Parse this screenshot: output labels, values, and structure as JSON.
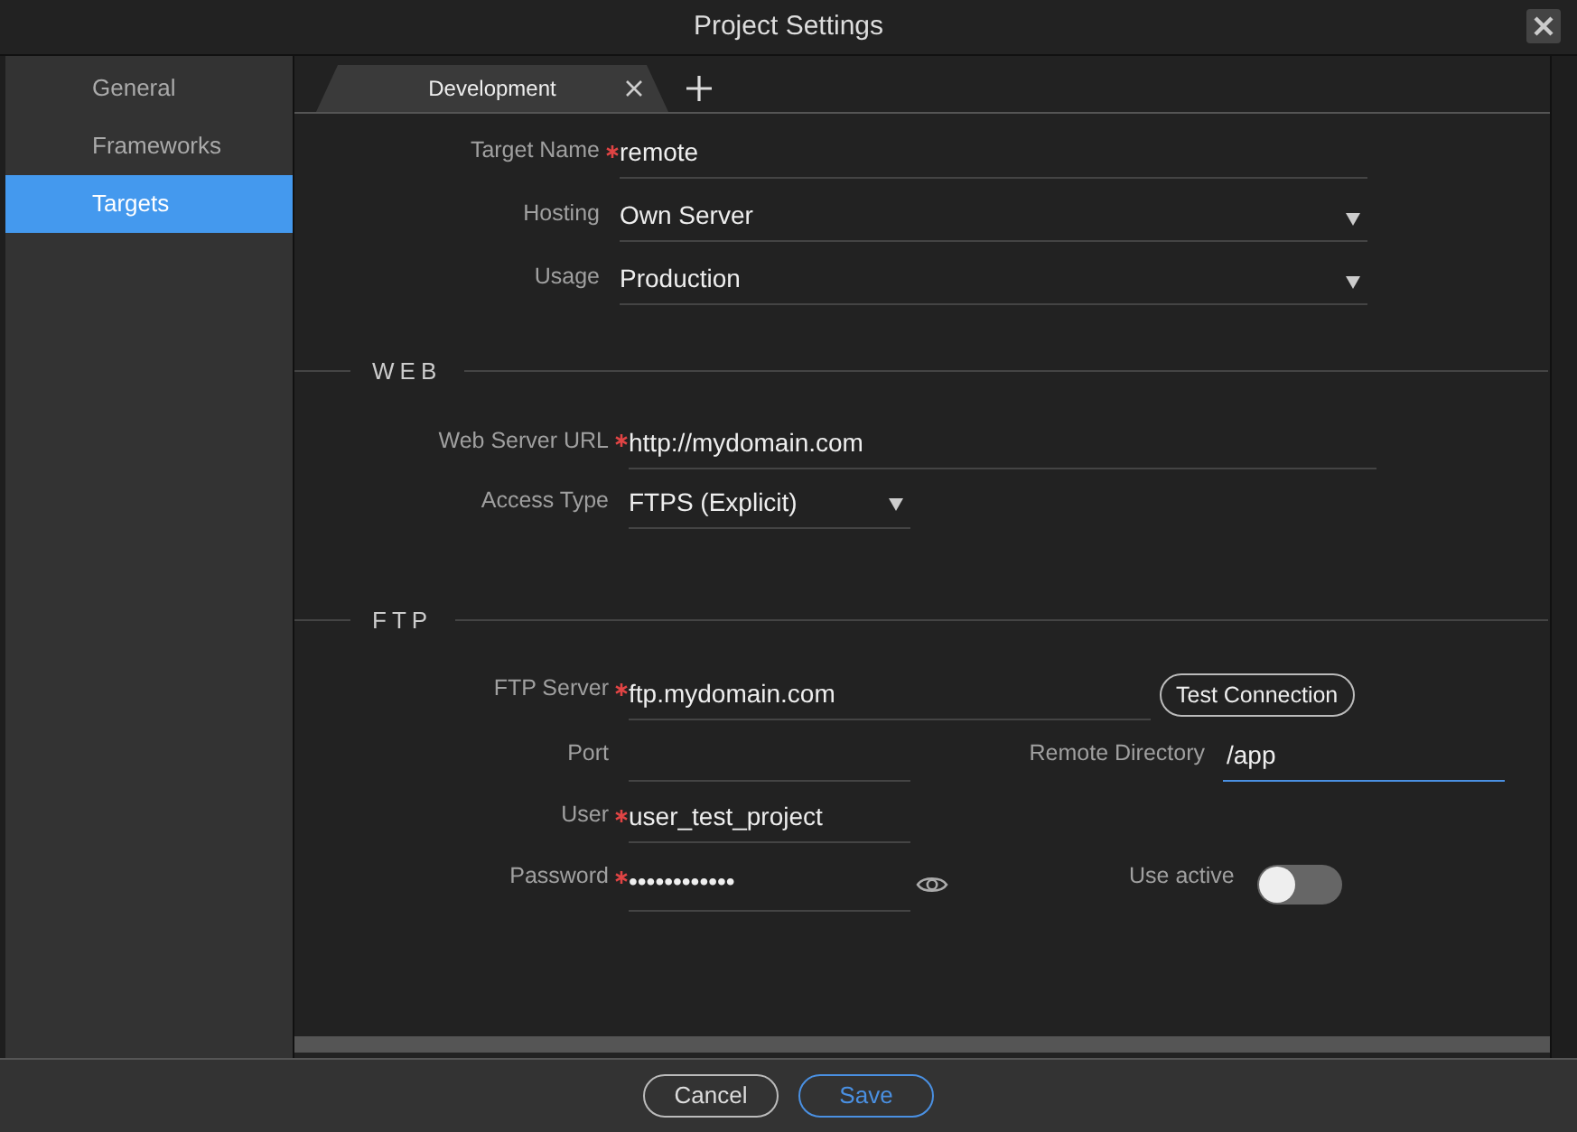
{
  "window": {
    "title": "Project Settings"
  },
  "sidebar": {
    "items": [
      {
        "label": "General",
        "selected": false
      },
      {
        "label": "Frameworks",
        "selected": false
      },
      {
        "label": "Targets",
        "selected": true
      }
    ]
  },
  "tabs": [
    {
      "label": "Development",
      "selected": true
    }
  ],
  "general": {
    "fields": [
      {
        "kind": "text",
        "label": "Target Name",
        "required": true,
        "value": "remote"
      },
      {
        "kind": "select",
        "label": "Hosting",
        "required": false,
        "value": "Own Server"
      },
      {
        "kind": "select",
        "label": "Usage",
        "required": false,
        "value": "Production"
      }
    ]
  },
  "web": {
    "title": "WEB",
    "fields": [
      {
        "kind": "text",
        "label": "Web Server URL",
        "required": true,
        "value": "http://mydomain.com"
      },
      {
        "kind": "select",
        "label": "Access Type",
        "required": false,
        "value": "FTPS (Explicit)"
      }
    ]
  },
  "ftp": {
    "title": "FTP",
    "server": {
      "label": "FTP Server",
      "required": true,
      "value": "ftp.mydomain.com"
    },
    "test_button": "Test Connection",
    "port": {
      "label": "Port",
      "required": false
    },
    "remote_directory": {
      "label": "Remote Directory",
      "value": "/app",
      "focused": true
    },
    "user": {
      "label": "User",
      "required": true,
      "value": "user_test_project"
    },
    "password": {
      "label": "Password",
      "required": true,
      "value": "••••••••••••"
    },
    "use_active": {
      "label": "Use active",
      "on": false
    }
  },
  "buttons": [
    {
      "label": "Cancel",
      "kind": "secondary"
    },
    {
      "label": "Save",
      "kind": "primary"
    }
  ]
}
